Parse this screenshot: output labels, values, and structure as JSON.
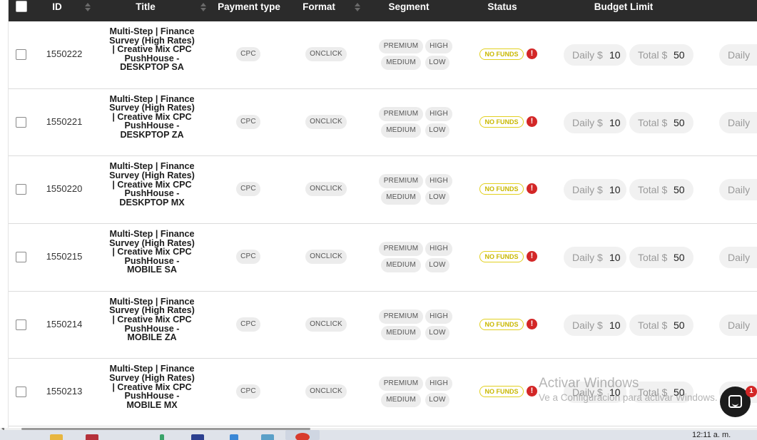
{
  "table": {
    "headers": {
      "id": "ID",
      "title": "Title",
      "payment_type": "Payment type",
      "format": "Format",
      "segment": "Segment",
      "status": "Status",
      "budget_limit": "Budget Limit"
    },
    "rows": [
      {
        "id": "1550222",
        "title": "Multi-Step | Finance Survey (High Rates) | Creative Mix CPC PushHouse - DESKPTOP SA",
        "payment": "CPC",
        "format": "ONCLICK",
        "seg_premium": "PREMIUM",
        "seg_high": "HIGH",
        "seg_medium": "MEDIUM",
        "seg_low": "LOW",
        "status": "NO FUNDS",
        "warn": "!",
        "daily_label": "Daily $",
        "daily_value": "10",
        "total_label": "Total $",
        "total_value": "50",
        "daily_label_2": "Daily"
      },
      {
        "id": "1550221",
        "title": "Multi-Step | Finance Survey (High Rates) | Creative Mix CPC PushHouse - DESKPTOP ZA",
        "payment": "CPC",
        "format": "ONCLICK",
        "seg_premium": "PREMIUM",
        "seg_high": "HIGH",
        "seg_medium": "MEDIUM",
        "seg_low": "LOW",
        "status": "NO FUNDS",
        "warn": "!",
        "daily_label": "Daily $",
        "daily_value": "10",
        "total_label": "Total $",
        "total_value": "50",
        "daily_label_2": "Daily"
      },
      {
        "id": "1550220",
        "title": "Multi-Step | Finance Survey (High Rates) | Creative Mix CPC PushHouse - DESKPTOP MX",
        "payment": "CPC",
        "format": "ONCLICK",
        "seg_premium": "PREMIUM",
        "seg_high": "HIGH",
        "seg_medium": "MEDIUM",
        "seg_low": "LOW",
        "status": "NO FUNDS",
        "warn": "!",
        "daily_label": "Daily $",
        "daily_value": "10",
        "total_label": "Total $",
        "total_value": "50",
        "daily_label_2": "Daily"
      },
      {
        "id": "1550215",
        "title": "Multi-Step | Finance Survey (High Rates) | Creative Mix CPC PushHouse - MOBILE SA",
        "payment": "CPC",
        "format": "ONCLICK",
        "seg_premium": "PREMIUM",
        "seg_high": "HIGH",
        "seg_medium": "MEDIUM",
        "seg_low": "LOW",
        "status": "NO FUNDS",
        "warn": "!",
        "daily_label": "Daily $",
        "daily_value": "10",
        "total_label": "Total $",
        "total_value": "50",
        "daily_label_2": "Daily"
      },
      {
        "id": "1550214",
        "title": "Multi-Step | Finance Survey (High Rates) | Creative Mix CPC PushHouse - MOBILE ZA",
        "payment": "CPC",
        "format": "ONCLICK",
        "seg_premium": "PREMIUM",
        "seg_high": "HIGH",
        "seg_medium": "MEDIUM",
        "seg_low": "LOW",
        "status": "NO FUNDS",
        "warn": "!",
        "daily_label": "Daily $",
        "daily_value": "10",
        "total_label": "Total $",
        "total_value": "50",
        "daily_label_2": "Daily"
      },
      {
        "id": "1550213",
        "title": "Multi-Step | Finance Survey (High Rates) | Creative Mix CPC PushHouse - MOBILE MX",
        "payment": "CPC",
        "format": "ONCLICK",
        "seg_premium": "PREMIUM",
        "seg_high": "HIGH",
        "seg_medium": "MEDIUM",
        "seg_low": "LOW",
        "status": "NO FUNDS",
        "warn": "!",
        "daily_label": "Daily $",
        "daily_value": "10",
        "total_label": "Total $",
        "total_value": "50",
        "daily_label_2": "Daily"
      }
    ]
  },
  "watermark": {
    "title": "Activar Windows",
    "subtitle": "Ve a Configuración para activar Windows."
  },
  "chat": {
    "icon": "chat-icon",
    "badge": "1"
  },
  "taskbar": {
    "clock": "12:11 a. m."
  },
  "colors": {
    "header_bg": "#2b2b2b",
    "status_yellow": "#e2d020",
    "warn_red": "#d32727",
    "pill_bg": "#ececec"
  }
}
